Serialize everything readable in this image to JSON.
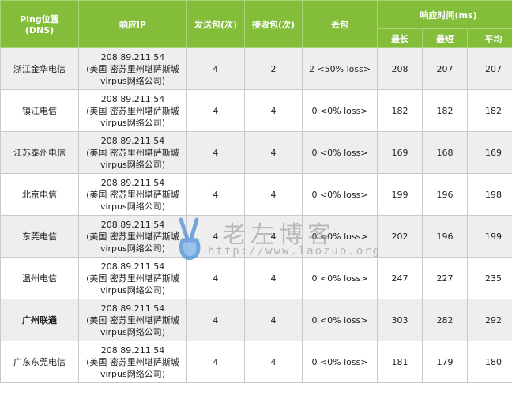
{
  "header": {
    "location": "Ping位置\n(DNS)",
    "ip": "响应IP",
    "sent": "发送包(次)",
    "received": "接收包(次)",
    "loss": "丢包",
    "response_time": "响应时间(ms)",
    "max": "最长",
    "min": "最短",
    "avg": "平均"
  },
  "rows": [
    {
      "location": "浙江金华电信",
      "ip": "208.89.211.54",
      "ip_geo": "(美国 密苏里州堪萨斯城",
      "ip_isp": "virpus网络公司)",
      "sent": "4",
      "received": "2",
      "loss": "2 <50% loss>",
      "max": "208",
      "min": "207",
      "avg": "207"
    },
    {
      "location": "镇江电信",
      "ip": "208.89.211.54",
      "ip_geo": "(美国 密苏里州堪萨斯城",
      "ip_isp": "virpus网络公司)",
      "sent": "4",
      "received": "4",
      "loss": "0 <0% loss>",
      "max": "182",
      "min": "182",
      "avg": "182"
    },
    {
      "location": "江苏泰州电信",
      "ip": "208.89.211.54",
      "ip_geo": "(美国 密苏里州堪萨斯城",
      "ip_isp": "virpus网络公司)",
      "sent": "4",
      "received": "4",
      "loss": "0 <0% loss>",
      "max": "169",
      "min": "168",
      "avg": "169"
    },
    {
      "location": "北京电信",
      "ip": "208.89.211.54",
      "ip_geo": "(美国 密苏里州堪萨斯城",
      "ip_isp": "virpus网络公司)",
      "sent": "4",
      "received": "4",
      "loss": "0 <0% loss>",
      "max": "199",
      "min": "196",
      "avg": "198"
    },
    {
      "location": "东莞电信",
      "ip": "208.89.211.54",
      "ip_geo": "(美国 密苏里州堪萨斯城",
      "ip_isp": "virpus网络公司)",
      "sent": "4",
      "received": "4",
      "loss": "0 <0% loss>",
      "max": "202",
      "min": "196",
      "avg": "199"
    },
    {
      "location": "温州电信",
      "ip": "208.89.211.54",
      "ip_geo": "(美国 密苏里州堪萨斯城",
      "ip_isp": "virpus网络公司)",
      "sent": "4",
      "received": "4",
      "loss": "0 <0% loss>",
      "max": "247",
      "min": "227",
      "avg": "235"
    },
    {
      "location": "广州联通",
      "ip": "208.89.211.54",
      "ip_geo": "(美国 密苏里州堪萨斯城",
      "ip_isp": "virpus网络公司)",
      "sent": "4",
      "received": "4",
      "loss": "0 <0% loss>",
      "max": "303",
      "min": "282",
      "avg": "292",
      "bold": true
    },
    {
      "location": "广东东莞电信",
      "ip": "208.89.211.54",
      "ip_geo": "(美国 密苏里州堪萨斯城",
      "ip_isp": "virpus网络公司)",
      "sent": "4",
      "received": "4",
      "loss": "0 <0% loss>",
      "max": "181",
      "min": "179",
      "avg": "180"
    }
  ],
  "watermark": {
    "title": "老左博客",
    "url": "http://www.laozuo.org",
    "icon": "victory-hand-icon"
  },
  "colors": {
    "header_bg": "#83bd3a",
    "row_alt_bg": "#eeeeee"
  }
}
